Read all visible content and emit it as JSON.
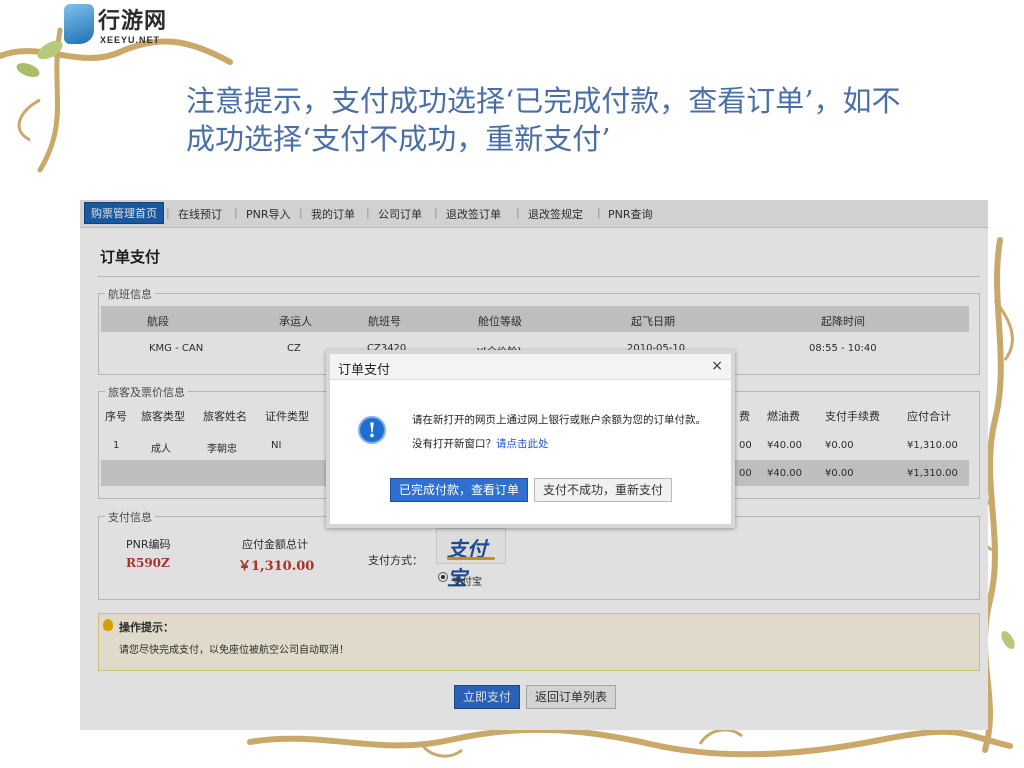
{
  "brand": {
    "name_cn": "行游网",
    "name_en": "XEEYU.NET"
  },
  "slide_title": "注意提示，支付成功选择‘已完成付款，查看订单’，如不成功选择‘支付不成功，重新支付’",
  "nav": {
    "items": [
      "购票管理首页",
      "在线预订",
      "PNR导入",
      "我的订单",
      "公司订单",
      "退改签订单",
      "退改签规定",
      "PNR查询"
    ]
  },
  "page": {
    "title": "订单支付"
  },
  "flight": {
    "legend": "航班信息",
    "headers": [
      "航段",
      "承运人",
      "航班号",
      "舱位等级",
      "起飞日期",
      "起降时间"
    ],
    "row": [
      "KMG - CAN",
      "CZ",
      "CZ3420",
      "Y[全价舱]",
      "2010-05-10",
      "08:55 - 10:40"
    ]
  },
  "passengers": {
    "legend": "旅客及票价信息",
    "headers_left": [
      "序号",
      "旅客类型",
      "旅客姓名",
      "证件类型"
    ],
    "headers_right": [
      "费",
      "燃油费",
      "支付手续费",
      "应付合计"
    ],
    "row_left": [
      "1",
      "成人",
      "李朝忠",
      "NI"
    ],
    "row_right": [
      "00",
      "¥40.00",
      "¥0.00",
      "¥1,310.00"
    ],
    "total_right": [
      "00",
      "¥40.00",
      "¥0.00",
      "¥1,310.00"
    ]
  },
  "payment": {
    "legend": "支付信息",
    "pnr_label": "PNR编码",
    "pnr_value": "R590Z",
    "amount_label": "应付金额总计",
    "amount_value": "￥1,310.00",
    "method_label": "支付方式：",
    "alipay_logo": "支付宝",
    "alipay_option": "支付宝"
  },
  "tip": {
    "title": "操作提示：",
    "text": "请您尽快完成支付，以免座位被航空公司自动取消！"
  },
  "actions": {
    "pay_now": "立即支付",
    "back_to_list": "返回订单列表"
  },
  "dialog": {
    "title": "订单支付",
    "close": "×",
    "message": "请在新打开的网页上通过网上银行或账户余额为您的订单付款。",
    "message2_prefix": "没有打开新窗口？",
    "message2_link": "请点击此处",
    "info_icon": "!",
    "btn_done": "已完成付款，查看订单",
    "btn_retry": "支付不成功，重新支付"
  },
  "colors": {
    "accent": "#1f64b4",
    "price": "#c0392b",
    "title_text": "#4a6fa5"
  }
}
